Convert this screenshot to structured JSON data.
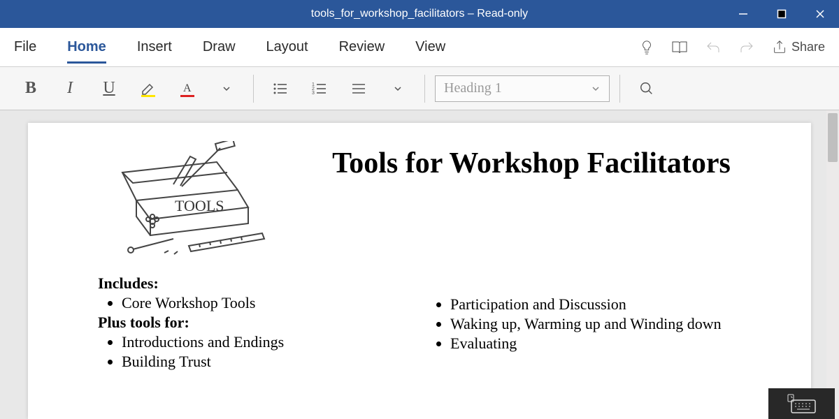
{
  "window": {
    "title": "tools_for_workshop_facilitators – Read-only"
  },
  "menubar": {
    "items": [
      "File",
      "Home",
      "Insert",
      "Draw",
      "Layout",
      "Review",
      "View"
    ],
    "active_index": 1,
    "share_label": "Share"
  },
  "ribbon": {
    "bold": "B",
    "italic": "I",
    "underline": "U",
    "style_selected": "Heading 1"
  },
  "document": {
    "title": "Tools for Workshop Facilitators",
    "left": {
      "label1": "Includes:",
      "items1": [
        "Core Workshop Tools"
      ],
      "label2": "Plus tools for:",
      "items2": [
        "Introductions and Endings",
        "Building Trust"
      ]
    },
    "right": {
      "items": [
        "Participation and Discussion",
        "Waking up, Warming up and Winding down",
        "Evaluating"
      ]
    },
    "image_label": "TOOLS"
  }
}
